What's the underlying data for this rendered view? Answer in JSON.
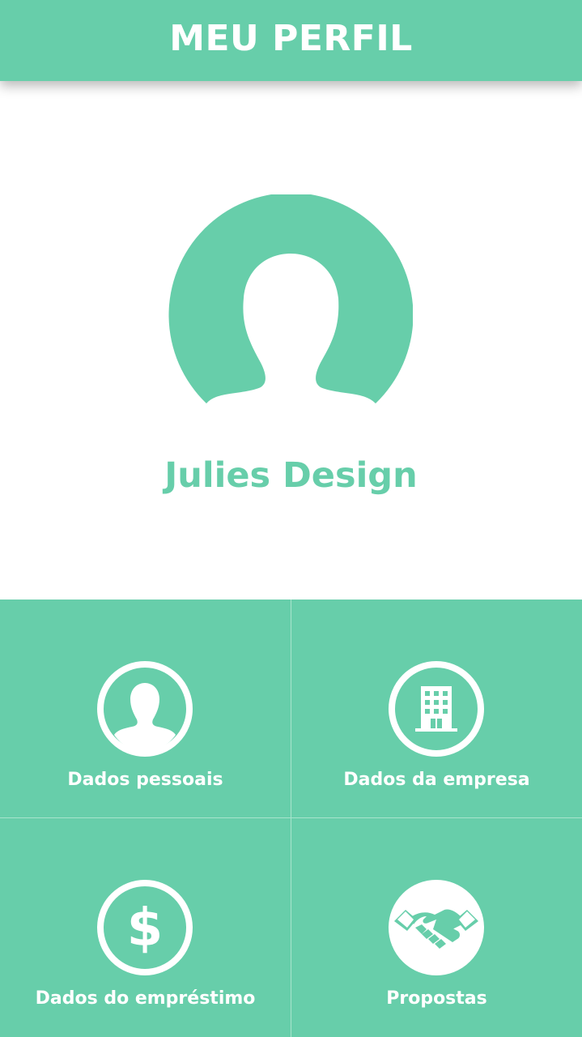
{
  "header": {
    "title": "MEU PERFIL"
  },
  "profile": {
    "avatar_icon": "user-silhouette-icon",
    "name": "Julies Design"
  },
  "menu": {
    "tiles": [
      {
        "label": "Dados pessoais",
        "icon": "person-icon"
      },
      {
        "label": "Dados da empresa",
        "icon": "building-icon"
      },
      {
        "label": "Dados do empréstimo",
        "icon": "dollar-icon"
      },
      {
        "label": "Propostas",
        "icon": "handshake-icon"
      }
    ]
  },
  "colors": {
    "accent": "#67ceaa",
    "text_on_accent": "#ffffff",
    "background": "#ffffff"
  }
}
